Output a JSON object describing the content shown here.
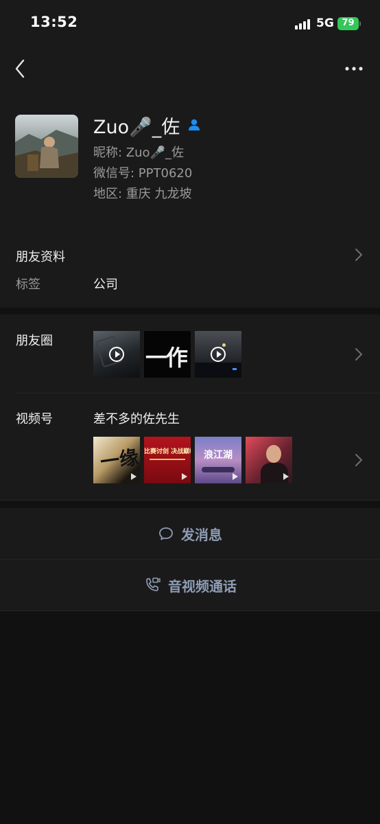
{
  "status_bar": {
    "time": "13:52",
    "network": "5G",
    "battery": "79"
  },
  "profile": {
    "display_name": "Zuo🎤_佐",
    "nickname_line": "昵称: Zuo🎤_佐",
    "wechat_id_line": "微信号: PPT0620",
    "region_line": "地区: 重庆  九龙坡"
  },
  "friend_info": {
    "title": "朋友资料",
    "tag_label": "标签",
    "tag_value": "公司"
  },
  "moments": {
    "title": "朋友圈",
    "thumb_text": "一作"
  },
  "channels": {
    "title": "视频号",
    "channel_name": "差不多的佐先生",
    "thumb_texts": [
      "一缘",
      "比赛讨剑 决战巅峰",
      "浪江湖"
    ]
  },
  "actions": {
    "message": "发消息",
    "call": "音视频通话"
  },
  "icons": {
    "back": "chevron-left-icon",
    "more": "more-dots-icon",
    "friend_badge": "person-icon",
    "message": "chat-bubble-icon",
    "call": "phone-video-icon"
  },
  "colors": {
    "background": "#111111",
    "card": "#1a1a1a",
    "accent_text": "#8e9cb5",
    "badge_blue": "#1f8ef1",
    "battery_green": "#34c759"
  }
}
